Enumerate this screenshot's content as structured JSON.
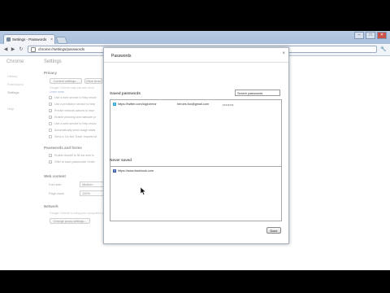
{
  "window": {
    "tab_title": "Settings - Passwords",
    "tab_close": "×",
    "controls": {
      "minimize": "–",
      "maximize": "□",
      "close": "✕"
    }
  },
  "toolbar": {
    "back": "◀",
    "forward": "▶",
    "reload": "↻",
    "url": "chrome://settings/passwords",
    "menu_icon": "wrench-icon"
  },
  "sidebar": {
    "title": "Chrome",
    "items": [
      {
        "label": "History"
      },
      {
        "label": "Extensions"
      },
      {
        "label": "Settings"
      },
      {
        "label": "Help"
      }
    ]
  },
  "settings": {
    "title": "Settings",
    "search_placeholder": "Search settings",
    "privacy": {
      "heading": "Privacy",
      "content_settings_btn": "Content settings...",
      "clear_btn": "Clear brow",
      "hint": "Google Chrome may use web servi",
      "hint_link": "Learn more",
      "checkboxes": [
        {
          "label": "Use a web service to help resolv",
          "checked": true
        },
        {
          "label": "Use a prediction service to help",
          "checked": true
        },
        {
          "label": "Predict network actions to impr",
          "checked": true
        },
        {
          "label": "Enable phishing and malware pr",
          "checked": true
        },
        {
          "label": "Use a web service to help resolv",
          "checked": false
        },
        {
          "label": "Automatically send usage statis",
          "checked": false
        },
        {
          "label": "Send a 'Do Not Track' request wi",
          "checked": false
        }
      ]
    },
    "passwords_forms": {
      "heading": "Passwords and forms",
      "checkboxes": [
        {
          "label": "Enable Autofill to fill out web fo",
          "checked": true
        },
        {
          "label": "Offer to save passwords I enter",
          "checked": true
        }
      ]
    },
    "web_content": {
      "heading": "Web content",
      "font_size_label": "Font size",
      "font_size_value": "Medium",
      "zoom_label": "Page zoom",
      "zoom_value": "100%"
    },
    "network": {
      "heading": "Network",
      "hint": "Google Chrome is using your computer's system proxy settings to connect to the network.",
      "proxy_btn": "Change proxy settings..."
    }
  },
  "dialog": {
    "title": "Passwords",
    "close": "×",
    "saved_heading": "Saved passwords",
    "search_value": "Search passwords",
    "saved": [
      {
        "site": "https://twitter.com/login/error",
        "username": "heroes.foo@gmail.com",
        "password": "••••••••",
        "icon": "twitter-icon"
      }
    ],
    "never_heading": "Never saved",
    "never": [
      {
        "site": "https://www.facebook.com",
        "icon": "facebook-icon"
      }
    ],
    "done_label": "Done"
  }
}
